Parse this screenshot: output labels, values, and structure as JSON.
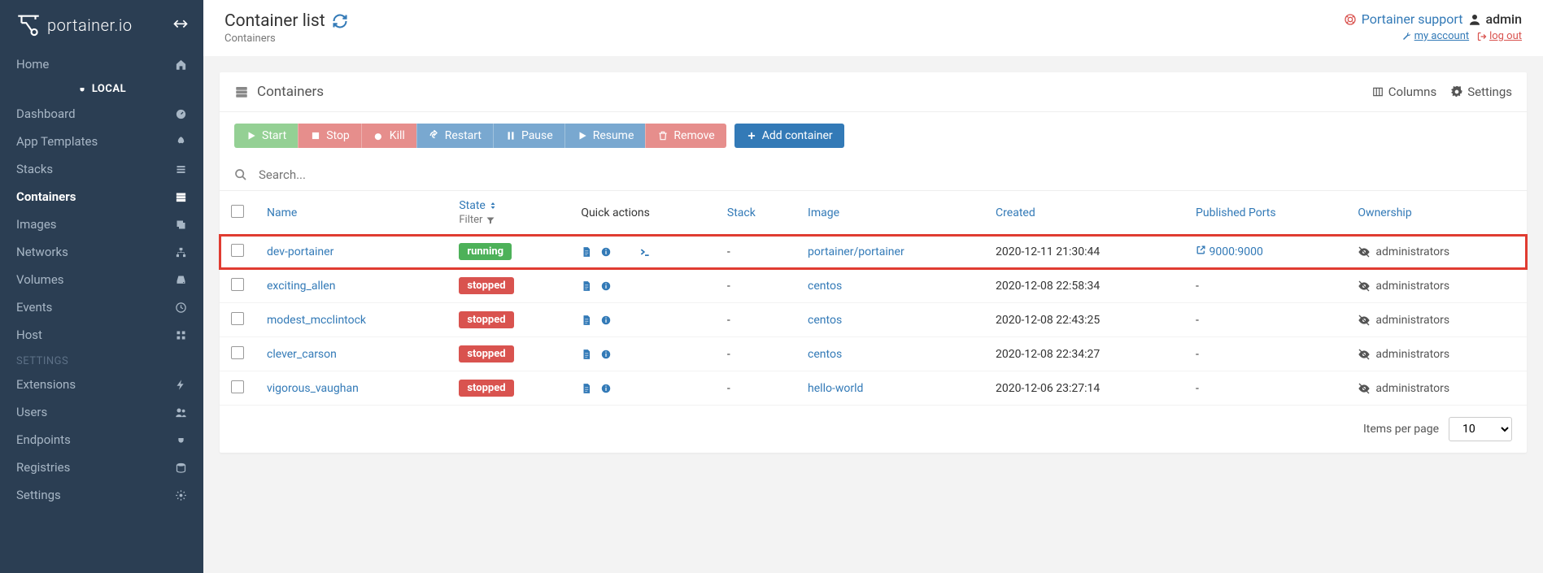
{
  "brand": "portainer.io",
  "sidebar": {
    "local_label": "LOCAL",
    "settings_label": "SETTINGS",
    "items": [
      {
        "label": "Home",
        "icon": "home"
      },
      {
        "label": "Dashboard",
        "icon": "dashboard"
      },
      {
        "label": "App Templates",
        "icon": "rocket"
      },
      {
        "label": "Stacks",
        "icon": "list"
      },
      {
        "label": "Containers",
        "icon": "server",
        "active": true
      },
      {
        "label": "Images",
        "icon": "layers"
      },
      {
        "label": "Networks",
        "icon": "sitemap"
      },
      {
        "label": "Volumes",
        "icon": "hdd"
      },
      {
        "label": "Events",
        "icon": "history"
      },
      {
        "label": "Host",
        "icon": "grid"
      }
    ],
    "settings_items": [
      {
        "label": "Extensions",
        "icon": "bolt"
      },
      {
        "label": "Users",
        "icon": "users"
      },
      {
        "label": "Endpoints",
        "icon": "plug"
      },
      {
        "label": "Registries",
        "icon": "database"
      },
      {
        "label": "Settings",
        "icon": "cogs"
      }
    ]
  },
  "topbar": {
    "title": "Container list",
    "breadcrumb": "Containers",
    "support": "Portainer support",
    "username": "admin",
    "my_account": "my account",
    "logout": "log out"
  },
  "panel": {
    "title": "Containers",
    "columns_label": "Columns",
    "settings_label": "Settings",
    "buttons": {
      "start": "Start",
      "stop": "Stop",
      "kill": "Kill",
      "restart": "Restart",
      "pause": "Pause",
      "resume": "Resume",
      "remove": "Remove",
      "add": "Add container"
    },
    "search_placeholder": "Search...",
    "headers": {
      "name": "Name",
      "state": "State",
      "state_filter": "Filter",
      "quick": "Quick actions",
      "stack": "Stack",
      "image": "Image",
      "created": "Created",
      "ports": "Published Ports",
      "owner": "Ownership"
    },
    "items_per_page_label": "Items per page",
    "items_per_page_value": "10"
  },
  "rows": [
    {
      "name": "dev-portainer",
      "state": "running",
      "quick": "full",
      "stack": "-",
      "image": "portainer/portainer",
      "created": "2020-12-11 21:30:44",
      "ports": "9000:9000",
      "owner": "administrators",
      "highlight": true
    },
    {
      "name": "exciting_allen",
      "state": "stopped",
      "quick": "min",
      "stack": "-",
      "image": "centos",
      "created": "2020-12-08 22:58:34",
      "ports": "-",
      "owner": "administrators"
    },
    {
      "name": "modest_mcclintock",
      "state": "stopped",
      "quick": "min",
      "stack": "-",
      "image": "centos",
      "created": "2020-12-08 22:43:25",
      "ports": "-",
      "owner": "administrators"
    },
    {
      "name": "clever_carson",
      "state": "stopped",
      "quick": "min",
      "stack": "-",
      "image": "centos",
      "created": "2020-12-08 22:34:27",
      "ports": "-",
      "owner": "administrators"
    },
    {
      "name": "vigorous_vaughan",
      "state": "stopped",
      "quick": "min",
      "stack": "-",
      "image": "hello-world",
      "created": "2020-12-06 23:27:14",
      "ports": "-",
      "owner": "administrators"
    }
  ]
}
